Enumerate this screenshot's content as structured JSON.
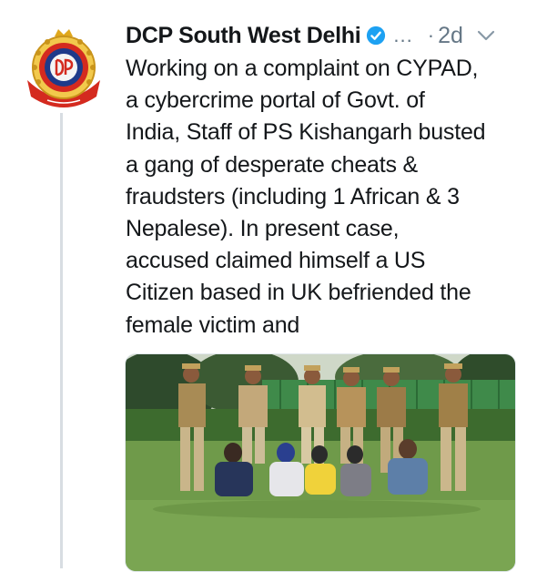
{
  "tweet": {
    "author_name": "DCP South West Delhi",
    "more_indicator": "...",
    "separator": "·",
    "timestamp": "2d",
    "text_lines": [
      "Working on a complaint on CYPAD,",
      "a cybercrime portal of Govt. of",
      "India, Staff of PS Kishangarh busted",
      "a gang of desperate cheats &",
      "fraudsters (including 1 African & 3",
      "Nepalese). In present case,",
      "accused claimed himself a US",
      "Citizen based in UK befriended the",
      "female victim and"
    ]
  },
  "icons": {
    "avatar": "delhi-police-emblem",
    "verified": "verified-badge-icon",
    "menu": "chevron-down-icon"
  },
  "colors": {
    "text": "#14171a",
    "secondary": "#657786",
    "verified": "#1da1f2",
    "thread_line": "#d8dde2",
    "emblem_red": "#d42a1f",
    "emblem_blue": "#1e3a8a",
    "emblem_gold": "#e0a81c"
  }
}
